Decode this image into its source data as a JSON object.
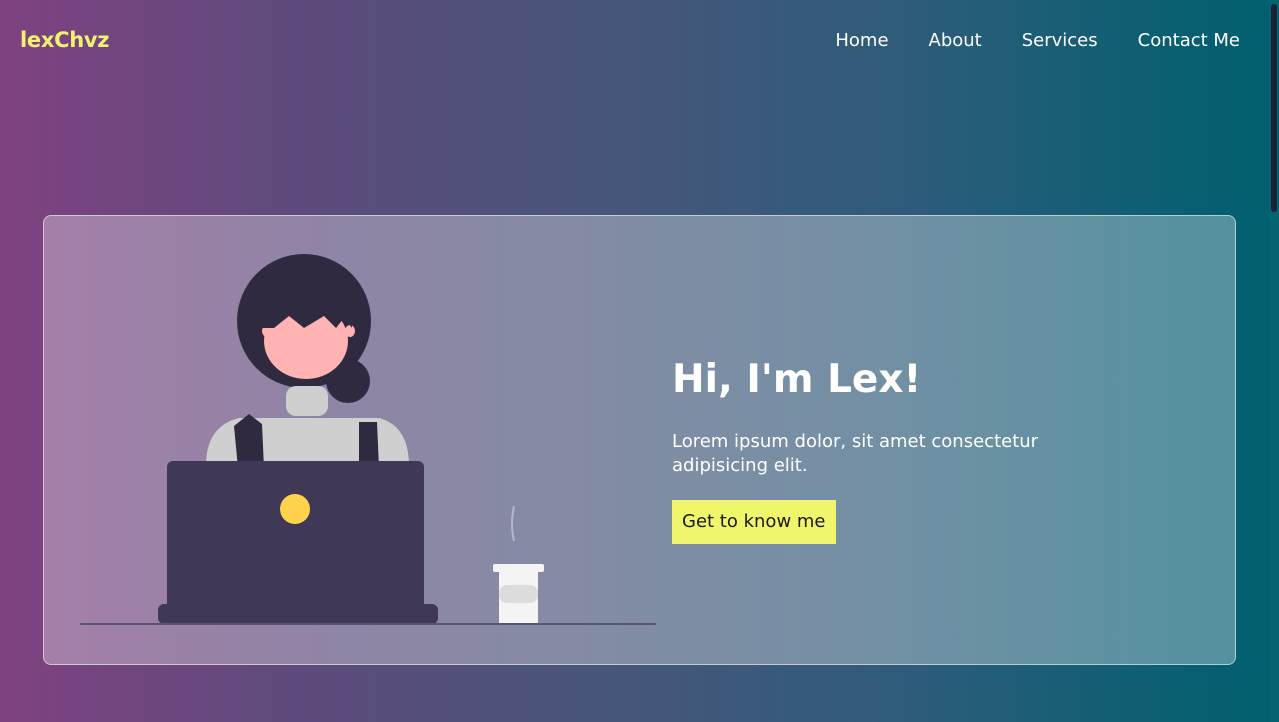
{
  "nav": {
    "logo": "lexChvz",
    "links": [
      "Home",
      "About",
      "Services",
      "Contact Me"
    ]
  },
  "hero": {
    "title": "Hi, I'm Lex!",
    "subtitle": "Lorem ipsum dolor, sit amet consectetur adipisicing elit.",
    "button_label": "Get to know me"
  },
  "colors": {
    "accent": "#f0f66b",
    "gradient_left": "#7f4281",
    "gradient_right": "#005f6f"
  }
}
